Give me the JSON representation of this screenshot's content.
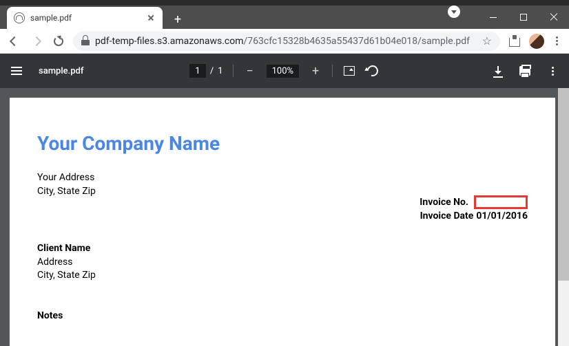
{
  "browser": {
    "tab_title": "sample.pdf",
    "url_host": "pdf-temp-files.s3.amazonaws.com",
    "url_path": "/763cfc15328b4635a55437d61b04e018/sample.pdf"
  },
  "pdfbar": {
    "filename": "sample.pdf",
    "page_current": "1",
    "page_total": "1",
    "zoom": "100%"
  },
  "doc": {
    "company_name": "Your Company Name",
    "company_addr1": "Your Address",
    "company_addr2": "City, State Zip",
    "invoice_no_label": "Invoice No.",
    "invoice_no_value": "",
    "invoice_date_label": "Invoice Date",
    "invoice_date_value": "01/01/2016",
    "client_name": "Client Name",
    "client_addr1": "Address",
    "client_addr2": "City, State Zip",
    "notes_label": "Notes"
  }
}
